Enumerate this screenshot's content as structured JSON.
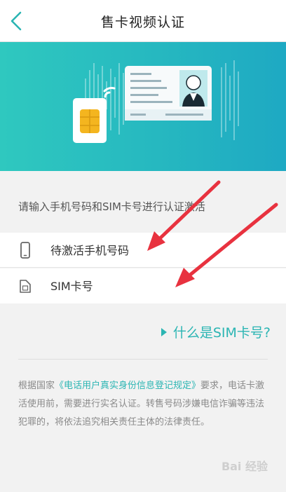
{
  "header": {
    "title": "售卡视频认证",
    "back_icon": "chevron-left-icon"
  },
  "banner": {
    "illustration": "sim-card-id-card-illustration"
  },
  "form": {
    "instruction": "请输入手机号码和SIM卡号进行认证激活",
    "phone_field": {
      "placeholder": "待激活手机号码",
      "value": "",
      "icon": "phone-icon"
    },
    "sim_field": {
      "placeholder": "SIM卡号",
      "value": "",
      "icon": "sim-card-icon"
    }
  },
  "help_link": {
    "label": "什么是SIM卡号?",
    "icon": "triangle-right-icon"
  },
  "notice": {
    "prefix": "根据国家",
    "regulation_link": "《电话用户真实身份信息登记规定》",
    "suffix": "要求，电话卡激活使用前，需要进行实名认证。转售号码涉嫌电信诈骗等违法犯罪的，将依法追究相关责任主体的法律责任。"
  },
  "watermark": "Bai 经验",
  "colors": {
    "accent": "#2bb5b3",
    "banner_start": "#2fc8bf",
    "banner_end": "#1ea9c3",
    "arrow": "#e8323f",
    "background": "#f2f2f2"
  }
}
